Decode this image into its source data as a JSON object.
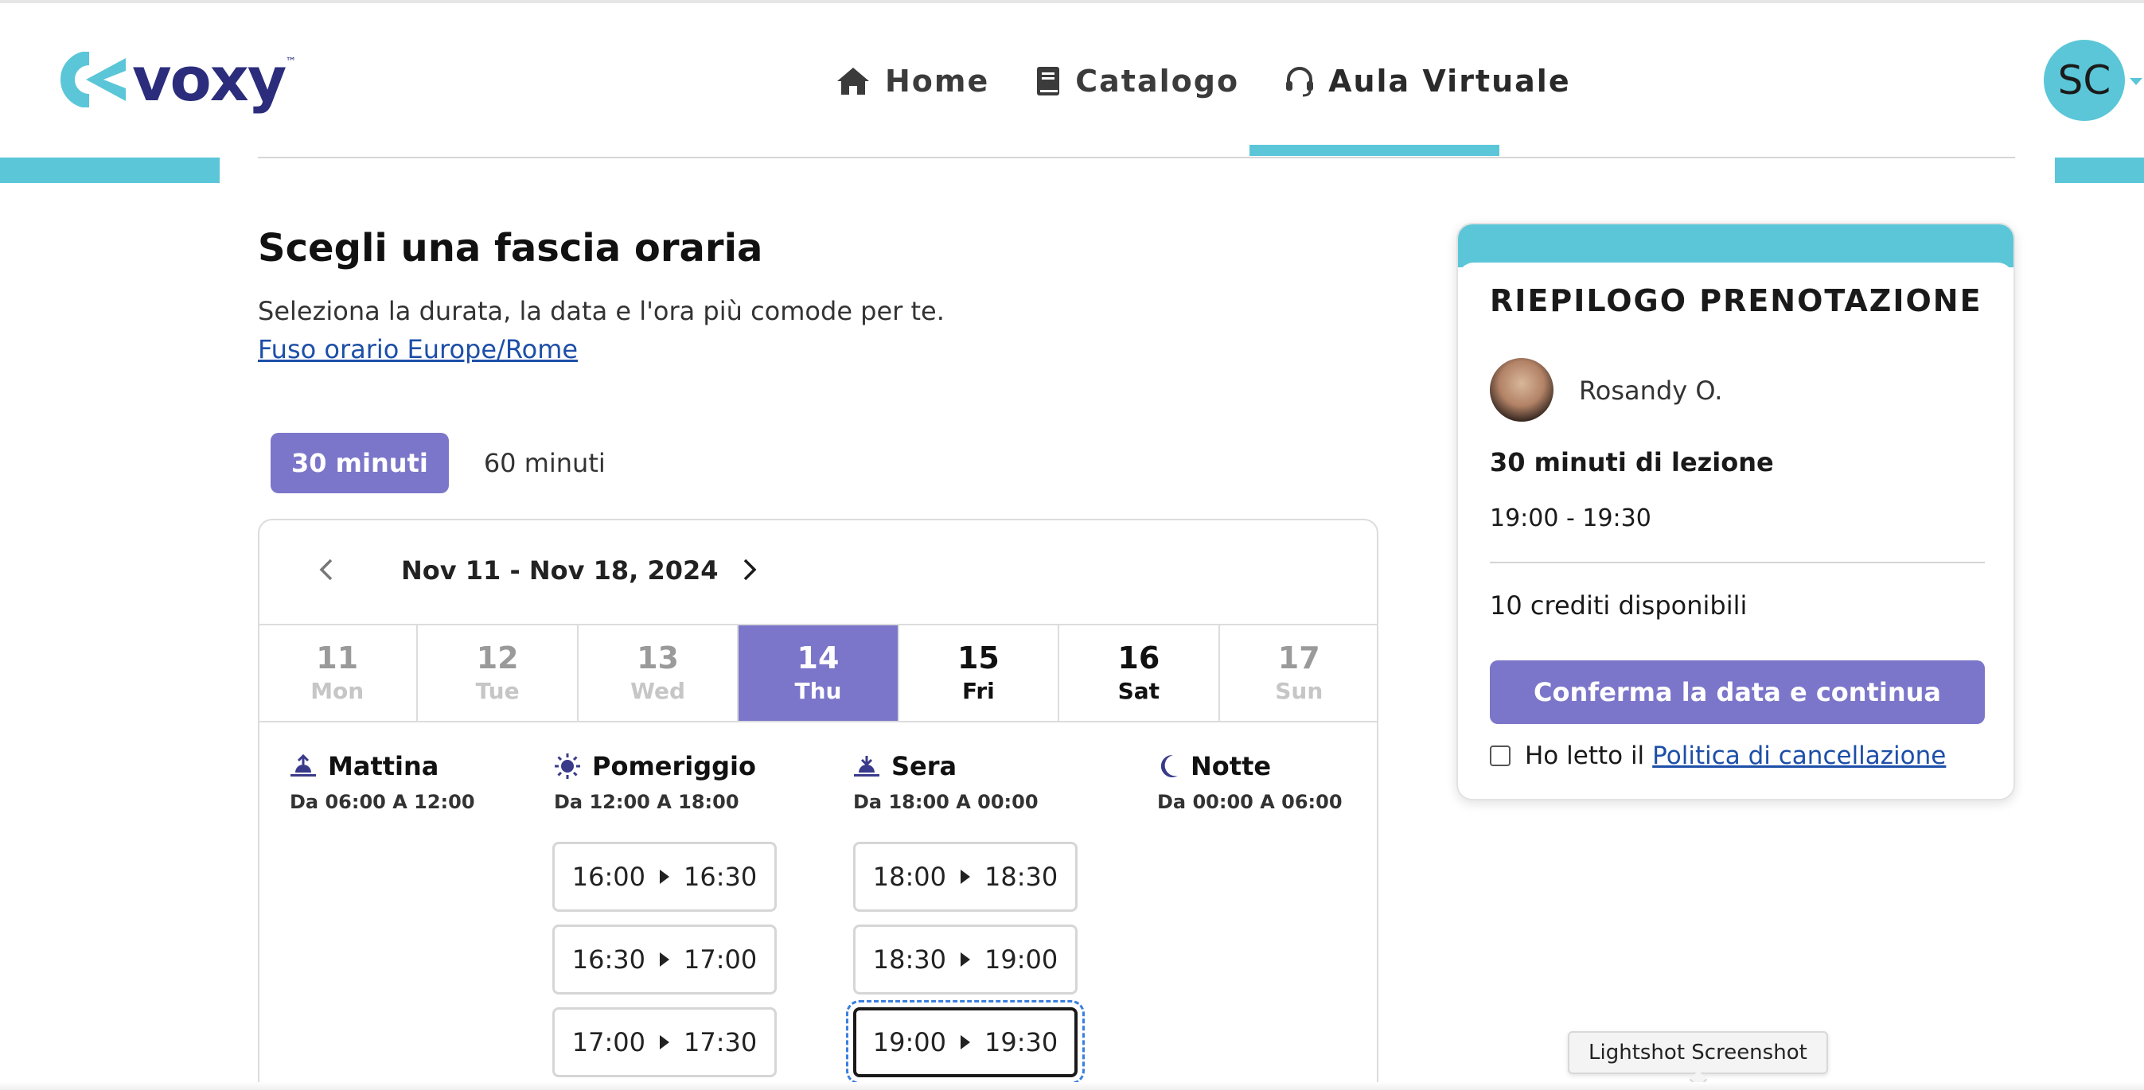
{
  "app": {
    "logo_text": "voxy",
    "logo_tm": "™",
    "user_initials": "SC"
  },
  "nav": {
    "items": [
      {
        "label": "Home",
        "icon": "home-icon"
      },
      {
        "label": "Catalogo",
        "icon": "book-icon"
      },
      {
        "label": "Aula Virtuale",
        "icon": "headset-icon",
        "active": true
      }
    ]
  },
  "page": {
    "title": "Scegli una fascia oraria",
    "subtitle": "Seleziona la durata, la data e l'ora più comode per te.",
    "timezone_link": "Fuso orario Europe/Rome"
  },
  "durations": {
    "options": [
      "30 minuti",
      "60 minuti"
    ],
    "selected": "30 minuti"
  },
  "calendar": {
    "range": "Nov 11 - Nov 18, 2024",
    "days": [
      {
        "num": "11",
        "wd": "Mon",
        "state": "past"
      },
      {
        "num": "12",
        "wd": "Tue",
        "state": "past"
      },
      {
        "num": "13",
        "wd": "Wed",
        "state": "past"
      },
      {
        "num": "14",
        "wd": "Thu",
        "state": "selected"
      },
      {
        "num": "15",
        "wd": "Fri",
        "state": "future"
      },
      {
        "num": "16",
        "wd": "Sat",
        "state": "future"
      },
      {
        "num": "17",
        "wd": "Sun",
        "state": "past"
      }
    ],
    "periods": [
      {
        "name": "Mattina",
        "range": "Da 06:00 A 12:00",
        "icon": "sunrise-icon"
      },
      {
        "name": "Pomeriggio",
        "range": "Da 12:00 A 18:00",
        "icon": "sun-icon"
      },
      {
        "name": "Sera",
        "range": "Da 18:00 A 00:00",
        "icon": "sunset-icon"
      },
      {
        "name": "Notte",
        "range": "Da 00:00 A 06:00",
        "icon": "moon-icon"
      }
    ],
    "slots": {
      "pomeriggio": [
        {
          "start": "16:00",
          "end": "16:30"
        },
        {
          "start": "16:30",
          "end": "17:00"
        },
        {
          "start": "17:00",
          "end": "17:30"
        }
      ],
      "sera": [
        {
          "start": "18:00",
          "end": "18:30"
        },
        {
          "start": "18:30",
          "end": "19:00"
        },
        {
          "start": "19:00",
          "end": "19:30",
          "selected": true
        }
      ]
    }
  },
  "summary": {
    "title": "RIEPILOGO PRENOTAZIONE",
    "tutor_name": "Rosandy O.",
    "lesson_type": "30 minuti di lezione",
    "lesson_time": "19:00 - 19:30",
    "credits": "10 crediti disponibili",
    "confirm_label": "Conferma la data e continua",
    "policy_prefix": "Ho letto il",
    "policy_link": "Politica di cancellazione"
  },
  "overlay": {
    "tooltip": "Lightshot Screenshot"
  },
  "colors": {
    "accent_teal": "#5bc6d8",
    "accent_purple": "#7b76c9",
    "brand_navy": "#2b2d7c",
    "link_blue": "#1d4fa8"
  }
}
